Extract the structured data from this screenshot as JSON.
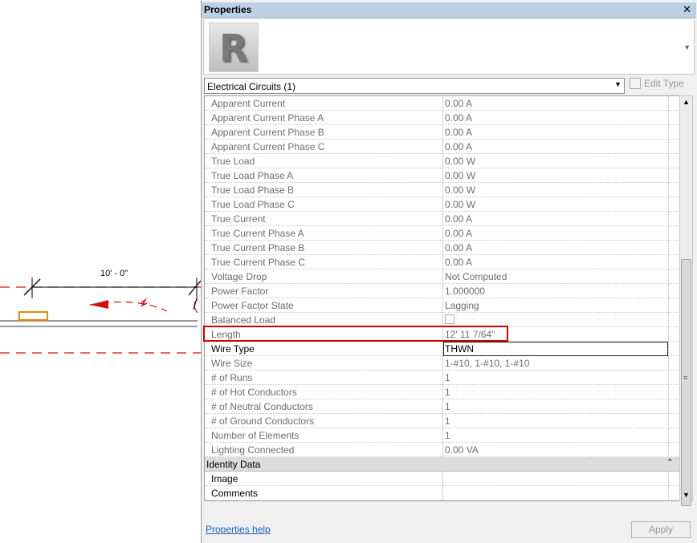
{
  "canvas": {
    "dimension_label": "10' - 0\""
  },
  "panel": {
    "title": "Properties",
    "close_glyph": "✕",
    "logo_letter": "R",
    "type_selector": {
      "value": "Electrical Circuits (1)"
    },
    "edit_type_label": "Edit Type",
    "params": [
      {
        "name": "Apparent Current",
        "value": "0.00 A"
      },
      {
        "name": "Apparent Current Phase A",
        "value": "0.00 A"
      },
      {
        "name": "Apparent Current Phase B",
        "value": "0.00 A"
      },
      {
        "name": "Apparent Current Phase C",
        "value": "0.00 A"
      },
      {
        "name": "True Load",
        "value": "0.00 W"
      },
      {
        "name": "True Load Phase A",
        "value": "0.00 W"
      },
      {
        "name": "True Load Phase B",
        "value": "0.00 W"
      },
      {
        "name": "True Load Phase C",
        "value": "0.00 W"
      },
      {
        "name": "True Current",
        "value": "0.00 A"
      },
      {
        "name": "True Current Phase A",
        "value": "0.00 A"
      },
      {
        "name": "True Current Phase B",
        "value": "0.00 A"
      },
      {
        "name": "True Current Phase C",
        "value": "0.00 A"
      },
      {
        "name": "Voltage Drop",
        "value": "Not Computed"
      },
      {
        "name": "Power Factor",
        "value": "1.000000"
      },
      {
        "name": "Power Factor State",
        "value": "Lagging"
      },
      {
        "name": "Balanced Load",
        "value": ""
      },
      {
        "name": "Length",
        "value": "12'  11 7/64\""
      },
      {
        "name": "Wire Type",
        "value": "THWN"
      },
      {
        "name": "Wire Size",
        "value": "1-#10, 1-#10, 1-#10"
      },
      {
        "name": "# of Runs",
        "value": "1"
      },
      {
        "name": "# of Hot Conductors",
        "value": "1"
      },
      {
        "name": "# of Neutral Conductors",
        "value": "1"
      },
      {
        "name": "# of Ground Conductors",
        "value": "1"
      },
      {
        "name": "Number of Elements",
        "value": "1"
      },
      {
        "name": "Lighting Connected",
        "value": "0.00 VA"
      }
    ],
    "identity_group": {
      "title": "Identity Data",
      "toggle_glyph": "⌃",
      "params": [
        {
          "name": "Image",
          "value": ""
        },
        {
          "name": "Comments",
          "value": ""
        }
      ]
    },
    "properties_help_label": "Properties help",
    "apply_label": "Apply"
  }
}
